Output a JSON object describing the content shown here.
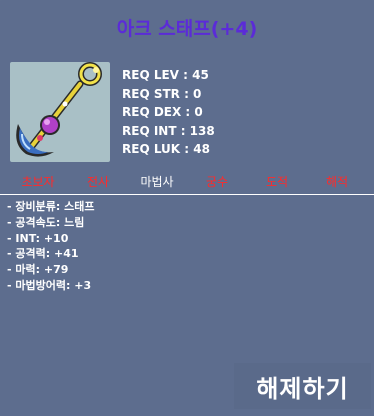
{
  "item": {
    "name": "아크 스태프(+4)",
    "icon": "staff-icon"
  },
  "requirements": [
    "REQ LEV : 45",
    "REQ STR : 0",
    "REQ DEX : 0",
    "REQ INT : 138",
    "REQ LUK : 48"
  ],
  "jobs": [
    {
      "label": "초보자",
      "active": false
    },
    {
      "label": "전사",
      "active": false
    },
    {
      "label": "마법사",
      "active": true
    },
    {
      "label": "궁수",
      "active": false
    },
    {
      "label": "도적",
      "active": false
    },
    {
      "label": "해적",
      "active": false
    }
  ],
  "stats": [
    "- 장비분류: 스태프",
    "- 공격속도: 느림",
    "- INT: +10",
    "- 공격력: +41",
    "- 마력: +79",
    "- 마법방어력: +3"
  ],
  "action": {
    "release_label": "해제하기"
  },
  "colors": {
    "background": "#5d6d8e",
    "title": "#5b2bd8",
    "job_disabled": "#ff2a2a",
    "job_enabled": "#ffffff"
  }
}
